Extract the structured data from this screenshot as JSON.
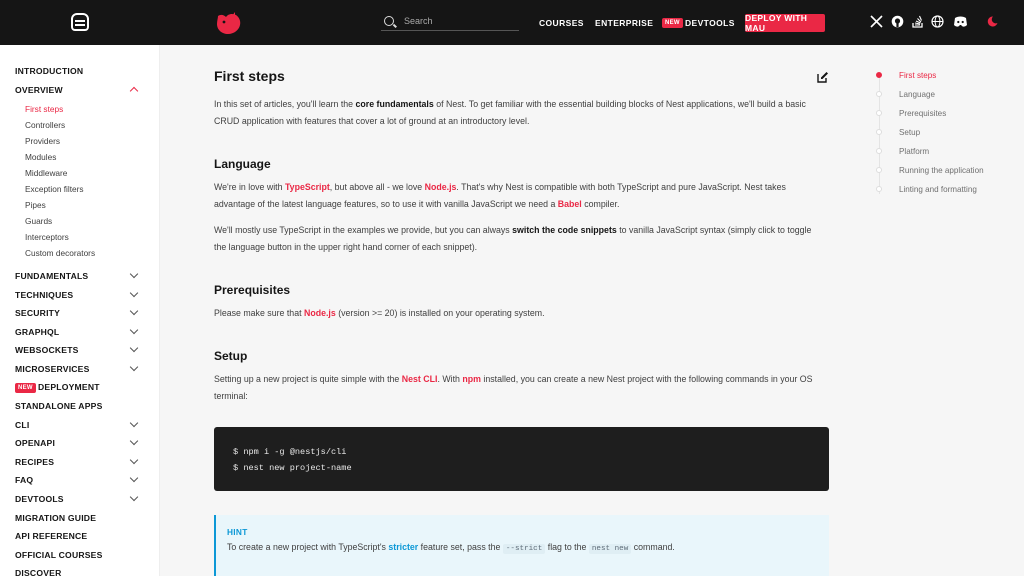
{
  "header": {
    "search_placeholder": "Search",
    "nav": {
      "courses": "COURSES",
      "enterprise": "ENTERPRISE",
      "new_badge": "NEW",
      "devtools": "DEVTOOLS",
      "deploy": "DEPLOY WITH MAU"
    },
    "icons": [
      "x-icon",
      "github-icon",
      "stackoverflow-icon",
      "globe-icon",
      "discord-icon",
      "theme-toggle-icon"
    ]
  },
  "sidebar": {
    "introduction": "INTRODUCTION",
    "overview": "OVERVIEW",
    "overview_items": [
      "First steps",
      "Controllers",
      "Providers",
      "Modules",
      "Middleware",
      "Exception filters",
      "Pipes",
      "Guards",
      "Interceptors",
      "Custom decorators"
    ],
    "sections": [
      "FUNDAMENTALS",
      "TECHNIQUES",
      "SECURITY",
      "GRAPHQL",
      "WEBSOCKETS",
      "MICROSERVICES"
    ],
    "deployment_badge": "NEW",
    "deployment": "DEPLOYMENT",
    "standalone": "STANDALONE APPS",
    "sections2": [
      "CLI",
      "OPENAPI",
      "RECIPES",
      "FAQ",
      "DEVTOOLS"
    ],
    "footer_items": [
      "MIGRATION GUIDE",
      "API REFERENCE",
      "OFFICIAL COURSES",
      "DISCOVER"
    ]
  },
  "main": {
    "title": "First steps",
    "intro_1": "In this set of articles, you'll learn the ",
    "intro_bold": "core fundamentals",
    "intro_2": " of Nest. To get familiar with the essential building blocks of Nest applications, we'll build a basic CRUD application with features that cover a lot of ground at an introductory level.",
    "lang_title": "Language",
    "lang_p1_a": "We're in love with ",
    "lang_p1_ts": "TypeScript",
    "lang_p1_b": ", but above all - we love ",
    "lang_p1_node": "Node.js",
    "lang_p1_c": ". That's why Nest is compatible with both TypeScript and pure JavaScript. Nest takes advantage of the latest language features, so to use it with vanilla JavaScript we need a ",
    "lang_p1_babel": "Babel",
    "lang_p1_d": " compiler.",
    "lang_p2_a": "We'll mostly use TypeScript in the examples we provide, but you can always ",
    "lang_p2_bold": "switch the code snippets",
    "lang_p2_b": " to vanilla JavaScript syntax (simply click to toggle the language button in the upper right hand corner of each snippet).",
    "prereq_title": "Prerequisites",
    "prereq_a": "Please make sure that ",
    "prereq_node": "Node.js",
    "prereq_b": " (version >= 20) is installed on your operating system.",
    "setup_title": "Setup",
    "setup_a": "Setting up a new project is quite simple with the ",
    "setup_cli": "Nest CLI",
    "setup_b": ". With ",
    "setup_npm": "npm",
    "setup_c": " installed, you can create a new Nest project with the following commands in your OS terminal:",
    "code_line1": "$ npm i -g @nestjs/cli",
    "code_line2": "$ nest new project-name",
    "hint_title": "HINT",
    "hint_a": "To create a new project with TypeScript's ",
    "hint_stricter": "stricter",
    "hint_b": " feature set, pass the ",
    "hint_code1": "--strict",
    "hint_c": " flag to the ",
    "hint_code2": "nest new",
    "hint_d": " command."
  },
  "toc": [
    "First steps",
    "Language",
    "Prerequisites",
    "Setup",
    "Platform",
    "Running the application",
    "Linting and formatting"
  ],
  "colors": {
    "brand": "#ea2845",
    "header_bg": "#151515",
    "hint": "#0c98d6"
  }
}
